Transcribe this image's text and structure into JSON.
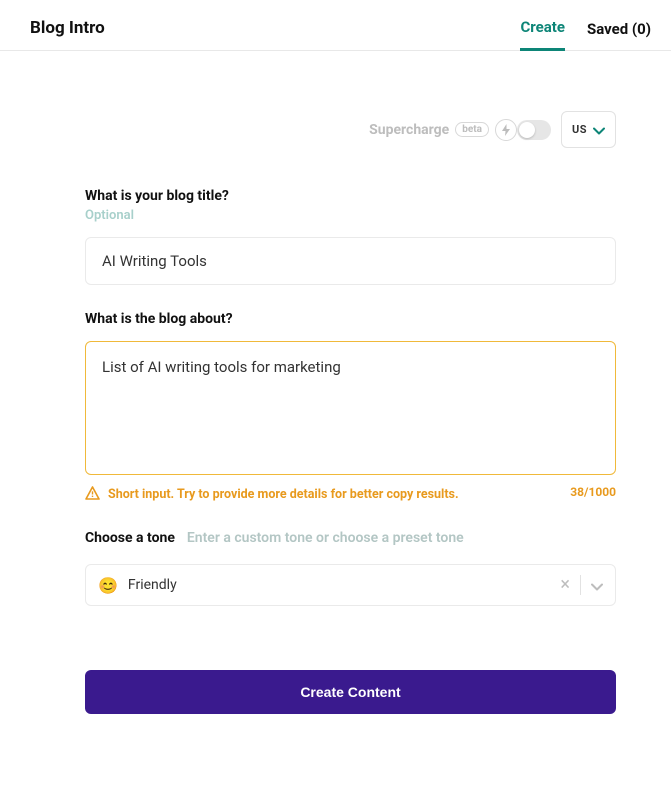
{
  "header": {
    "title": "Blog Intro",
    "tabs": {
      "create": "Create",
      "saved": "Saved (0)"
    }
  },
  "supercharge": {
    "label": "Supercharge",
    "badge": "beta"
  },
  "region": {
    "code": "US"
  },
  "title_field": {
    "label": "What is your blog title?",
    "sublabel": "Optional",
    "value": "AI Writing Tools"
  },
  "about_field": {
    "label": "What is the blog about?",
    "value": "List of AI writing tools for marketing",
    "warning": "Short input. Try to provide more details for better copy results.",
    "count": "38/1000"
  },
  "tone": {
    "label": "Choose a tone",
    "placeholder": "Enter a custom tone or choose a preset tone",
    "emoji": "😊",
    "value": "Friendly"
  },
  "submit": {
    "label": "Create Content"
  }
}
